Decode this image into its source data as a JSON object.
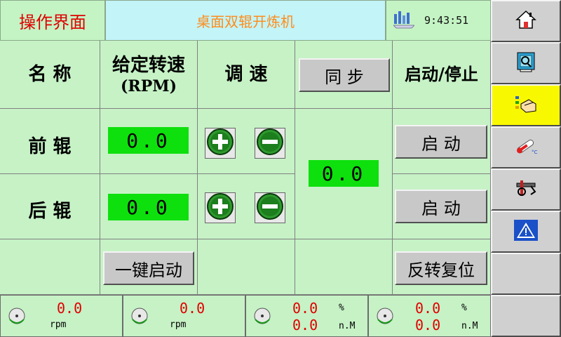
{
  "header": {
    "title": "操作界面",
    "machine": "桌面双辊开炼机",
    "time": "9:43:51"
  },
  "table": {
    "col_name": "名  称",
    "col_speed_line1": "给定转速",
    "col_speed_line2": "(RPM)",
    "col_adjust": "调   速",
    "sync_label": "同   步",
    "col_start_stop": "启动/停止",
    "front_label": "前  辊",
    "rear_label": "后  辊",
    "front_speed": "0.0",
    "rear_speed": "0.0",
    "sync_value": "0.0",
    "front_start": "启   动",
    "rear_start": "启   动",
    "one_key_start": "一键启动",
    "reverse_reset": "反转复位"
  },
  "footer": [
    {
      "value": "0.0",
      "unit": "rpm"
    },
    {
      "value": "0.0",
      "unit": "rpm"
    },
    {
      "value1": "0.0",
      "unit1": "%",
      "value2": "0.0",
      "unit2": "n.M"
    },
    {
      "value1": "0.0",
      "unit1": "%",
      "value2": "0.0",
      "unit2": "n.M"
    }
  ],
  "sidebar": {
    "icons": [
      "home-icon",
      "monitor-icon",
      "hand-pointer-icon",
      "thermometer-icon",
      "tools-icon",
      "warning-icon"
    ],
    "accent_active": "#f8f800"
  },
  "colors": {
    "background": "#c8f0c8",
    "value_box": "#0ee00e",
    "title_red": "#e00000",
    "title_orange": "#ff8c1a"
  }
}
